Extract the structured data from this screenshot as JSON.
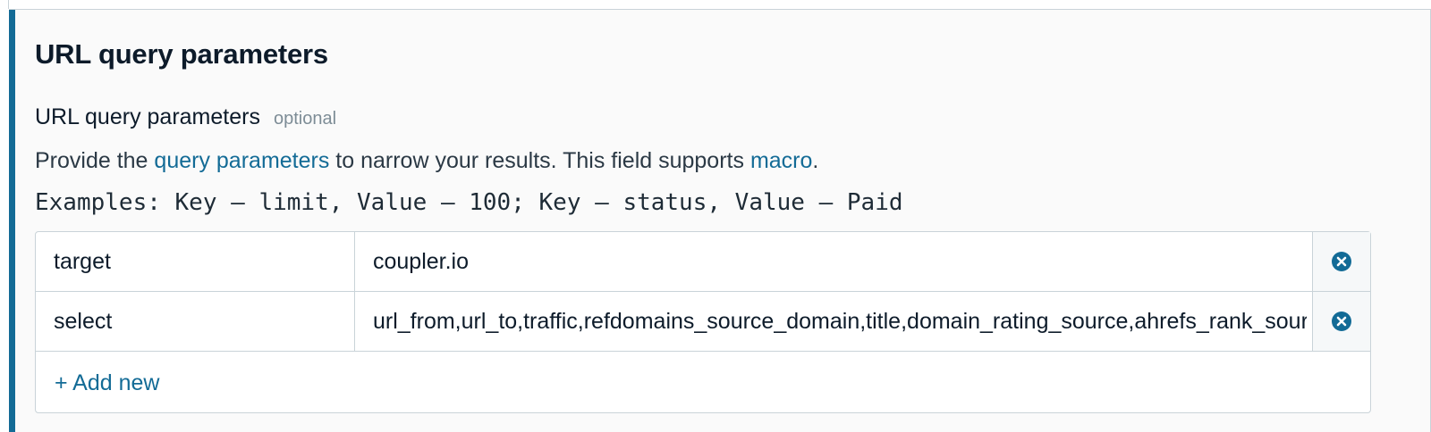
{
  "section": {
    "title": "URL query parameters"
  },
  "field": {
    "label": "URL query parameters",
    "optional": "optional",
    "help_prefix": "Provide the ",
    "help_link_query": "query parameters",
    "help_middle": " to narrow your results. This field supports ",
    "help_link_macro": "macro",
    "help_suffix": ".",
    "examples": "Examples: Key – limit, Value – 100; Key – status, Value – Paid"
  },
  "params": {
    "rows": [
      {
        "key": "target",
        "value": "coupler.io",
        "remove_icon": "close-circle-icon"
      },
      {
        "key": "select",
        "value": "url_from,url_to,traffic,refdomains_source_domain,title,domain_rating_source,ahrefs_rank_source",
        "remove_icon": "close-circle-icon"
      }
    ],
    "add_new_label": "+ Add new"
  },
  "colors": {
    "accent": "#136b96",
    "link": "#136b96",
    "remove_icon": "#136b96",
    "border": "#c9d3d8"
  }
}
